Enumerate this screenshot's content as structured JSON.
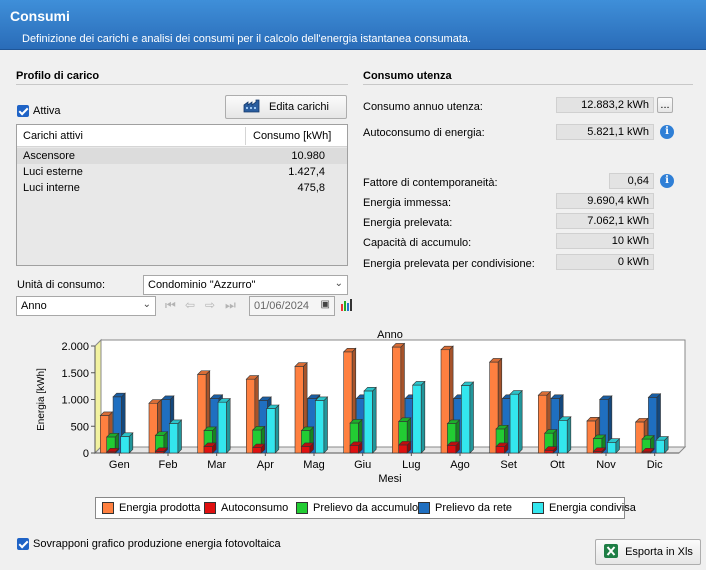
{
  "header": {
    "title": "Consumi",
    "description": "Definizione dei carichi e analisi dei consumi per il calcolo dell'energia istantanea consumata."
  },
  "profile": {
    "section_title": "Profilo di carico",
    "active_label": "Attiva",
    "edit_button": "Edita carichi",
    "table": {
      "col1": "Carichi attivi",
      "col2": "Consumo [kWh]",
      "rows": [
        {
          "name": "Ascensore",
          "value": "10.980"
        },
        {
          "name": "Luci esterne",
          "value": "1.427,4"
        },
        {
          "name": "Luci interne",
          "value": "475,8"
        }
      ]
    },
    "unit_label": "Unità di consumo:",
    "unit_value": "Condominio \"Azzurro\"",
    "period_value": "Anno",
    "date_value": "01/06/2024"
  },
  "usage": {
    "section_title": "Consumo utenza",
    "rows": [
      {
        "label": "Consumo annuo utenza:",
        "value": "12.883,2 kWh"
      },
      {
        "label": "Autoconsumo di energia:",
        "value": "5.821,1 kWh"
      },
      {
        "label": "Fattore di contemporaneità:",
        "value": "0,64"
      },
      {
        "label": "Energia immessa:",
        "value": "9.690,4 kWh"
      },
      {
        "label": "Energia prelevata:",
        "value": "7.062,1 kWh"
      },
      {
        "label": "Capacità di accumulo:",
        "value": "10 kWh"
      },
      {
        "label": "Energia prelevata per condivisione:",
        "value": "0 kWh"
      }
    ],
    "more_button": "..."
  },
  "chart_data": {
    "type": "bar",
    "title": "Anno",
    "xlabel": "Mesi",
    "ylabel": "Energia [kWh]",
    "ylim": [
      0,
      2000
    ],
    "yticks": [
      "0",
      "500",
      "1.000",
      "1.500",
      "2.000"
    ],
    "categories": [
      "Gen",
      "Feb",
      "Mar",
      "Apr",
      "Mag",
      "Giu",
      "Lug",
      "Ago",
      "Set",
      "Ott",
      "Nov",
      "Dic"
    ],
    "series": [
      {
        "name": "Energia prodotta",
        "color": "#ff8040",
        "values": [
          700,
          930,
          1470,
          1380,
          1620,
          1890,
          1980,
          1930,
          1700,
          1080,
          600,
          580
        ]
      },
      {
        "name": "Autoconsumo",
        "color": "#e01010",
        "values": [
          20,
          30,
          120,
          100,
          120,
          140,
          150,
          140,
          120,
          50,
          30,
          20
        ]
      },
      {
        "name": "Prelievo da accumulo",
        "color": "#22cc33",
        "values": [
          300,
          330,
          420,
          430,
          420,
          560,
          590,
          550,
          450,
          370,
          270,
          260
        ]
      },
      {
        "name": "Prelievo da rete",
        "color": "#1f6fc0",
        "values": [
          1050,
          1000,
          1020,
          980,
          1020,
          1020,
          1020,
          1020,
          1020,
          1020,
          1000,
          1040
        ]
      },
      {
        "name": "Energia condivisa",
        "color": "#33e6ee",
        "values": [
          310,
          550,
          950,
          830,
          980,
          1160,
          1270,
          1260,
          1100,
          610,
          200,
          240
        ]
      }
    ],
    "legend_position": "bottom",
    "grid": false
  },
  "footer": {
    "overlay_label": "Sovrapponi grafico produzione energia fotovoltaica",
    "export_button": "Esporta in Xls"
  }
}
